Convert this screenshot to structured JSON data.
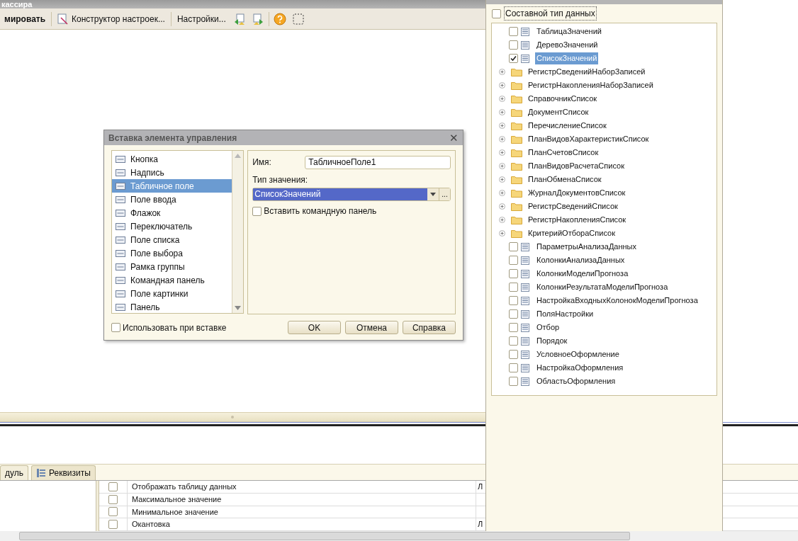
{
  "main_window": {
    "title": "кассира",
    "toolbar": [
      {
        "kind": "text",
        "label": "мировать",
        "bold": true
      },
      {
        "kind": "icon-text",
        "label": "Конструктор настроек..."
      },
      {
        "kind": "text",
        "label": "Настройки...",
        "bold": false
      },
      {
        "kind": "import"
      },
      {
        "kind": "export"
      },
      {
        "kind": "help"
      },
      {
        "kind": "select"
      }
    ],
    "tabs": [
      {
        "label": "дуль",
        "selected": false
      },
      {
        "label": "Реквизиты",
        "selected": true
      }
    ],
    "rows": [
      {
        "checked": false,
        "name": "Отображать таблицу данных",
        "column_3": "Л"
      },
      {
        "checked": false,
        "name": "Максимальное значение"
      },
      {
        "checked": false,
        "name": "Минимальное значение"
      },
      {
        "checked": false,
        "name": "Окантовка",
        "column_3": "Л"
      }
    ]
  },
  "insert_dialog": {
    "title": "Вставка элемента управления",
    "close": "✕",
    "items": [
      {
        "label": "Кнопка",
        "selected": false
      },
      {
        "label": "Надпись",
        "selected": false
      },
      {
        "label": "Табличное поле",
        "selected": true
      },
      {
        "label": "Поле ввода",
        "selected": false
      },
      {
        "label": "Флажок",
        "selected": false
      },
      {
        "label": "Переключатель",
        "selected": false
      },
      {
        "label": "Поле списка",
        "selected": false
      },
      {
        "label": "Поле выбора",
        "selected": false
      },
      {
        "label": "Рамка группы",
        "selected": false
      },
      {
        "label": "Командная панель",
        "selected": false
      },
      {
        "label": "Поле картинки",
        "selected": false
      },
      {
        "label": "Панель",
        "selected": false
      }
    ],
    "name_label": "Имя:",
    "name_value": "ТабличноеПоле1",
    "type_label": "Тип значения:",
    "type_value": "СписокЗначений",
    "choose_button": "...",
    "insert_panel": {
      "label": "Вставить командную панель",
      "checked": false
    },
    "use_on_insert": {
      "label": "Использовать при вставке",
      "checked": false
    },
    "buttons": [
      "OK",
      "Отмена",
      "Справка"
    ]
  },
  "type_panel": {
    "composite": {
      "label": "Составной тип данных",
      "checked": false
    },
    "items": [
      {
        "kind": "checkbox",
        "label": "ТаблицаЗначений",
        "checked": false,
        "selected": false
      },
      {
        "kind": "checkbox",
        "label": "ДеревоЗначений",
        "checked": false,
        "selected": false
      },
      {
        "kind": "checkbox",
        "label": "СписокЗначений",
        "checked": true,
        "selected": true
      },
      {
        "kind": "folder",
        "label": "РегистрСведенийНаборЗаписей",
        "expanded": false
      },
      {
        "kind": "folder",
        "label": "РегистрНакопленияНаборЗаписей",
        "expanded": false
      },
      {
        "kind": "folder",
        "label": "СправочникСписок",
        "expanded": false
      },
      {
        "kind": "folder",
        "label": "ДокументСписок",
        "expanded": false
      },
      {
        "kind": "folder",
        "label": "ПеречислениеСписок",
        "expanded": false
      },
      {
        "kind": "folder",
        "label": "ПланВидовХарактеристикСписок",
        "expanded": false
      },
      {
        "kind": "folder",
        "label": "ПланСчетовСписок",
        "expanded": false
      },
      {
        "kind": "folder",
        "label": "ПланВидовРасчетаСписок",
        "expanded": false
      },
      {
        "kind": "folder",
        "label": "ПланОбменаСписок",
        "expanded": false
      },
      {
        "kind": "folder",
        "label": "ЖурналДокументовСписок",
        "expanded": false
      },
      {
        "kind": "folder",
        "label": "РегистрСведенийСписок",
        "expanded": false
      },
      {
        "kind": "folder",
        "label": "РегистрНакопленияСписок",
        "expanded": false
      },
      {
        "kind": "folder",
        "label": "КритерийОтбораСписок",
        "expanded": false
      },
      {
        "kind": "checkbox",
        "label": "ПараметрыАнализаДанных",
        "checked": false,
        "selected": false
      },
      {
        "kind": "checkbox",
        "label": "КолонкиАнализаДанных",
        "checked": false,
        "selected": false
      },
      {
        "kind": "checkbox",
        "label": "КолонкиМоделиПрогноза",
        "checked": false,
        "selected": false
      },
      {
        "kind": "checkbox",
        "label": "КолонкиРезультатаМоделиПрогноза",
        "checked": false,
        "selected": false
      },
      {
        "kind": "checkbox",
        "label": "НастройкаВходныхКолонокМоделиПрогноза",
        "checked": false,
        "selected": false
      },
      {
        "kind": "checkbox",
        "label": "ПоляНастройки",
        "checked": false,
        "selected": false
      },
      {
        "kind": "checkbox",
        "label": "Отбор",
        "checked": false,
        "selected": false
      },
      {
        "kind": "checkbox",
        "label": "Порядок",
        "checked": false,
        "selected": false
      },
      {
        "kind": "checkbox",
        "label": "УсловноеОформление",
        "checked": false,
        "selected": false
      },
      {
        "kind": "checkbox",
        "label": "НастройкаОформления",
        "checked": false,
        "selected": false
      },
      {
        "kind": "checkbox",
        "label": "ОбластьОформления",
        "checked": false,
        "selected": false
      }
    ]
  }
}
